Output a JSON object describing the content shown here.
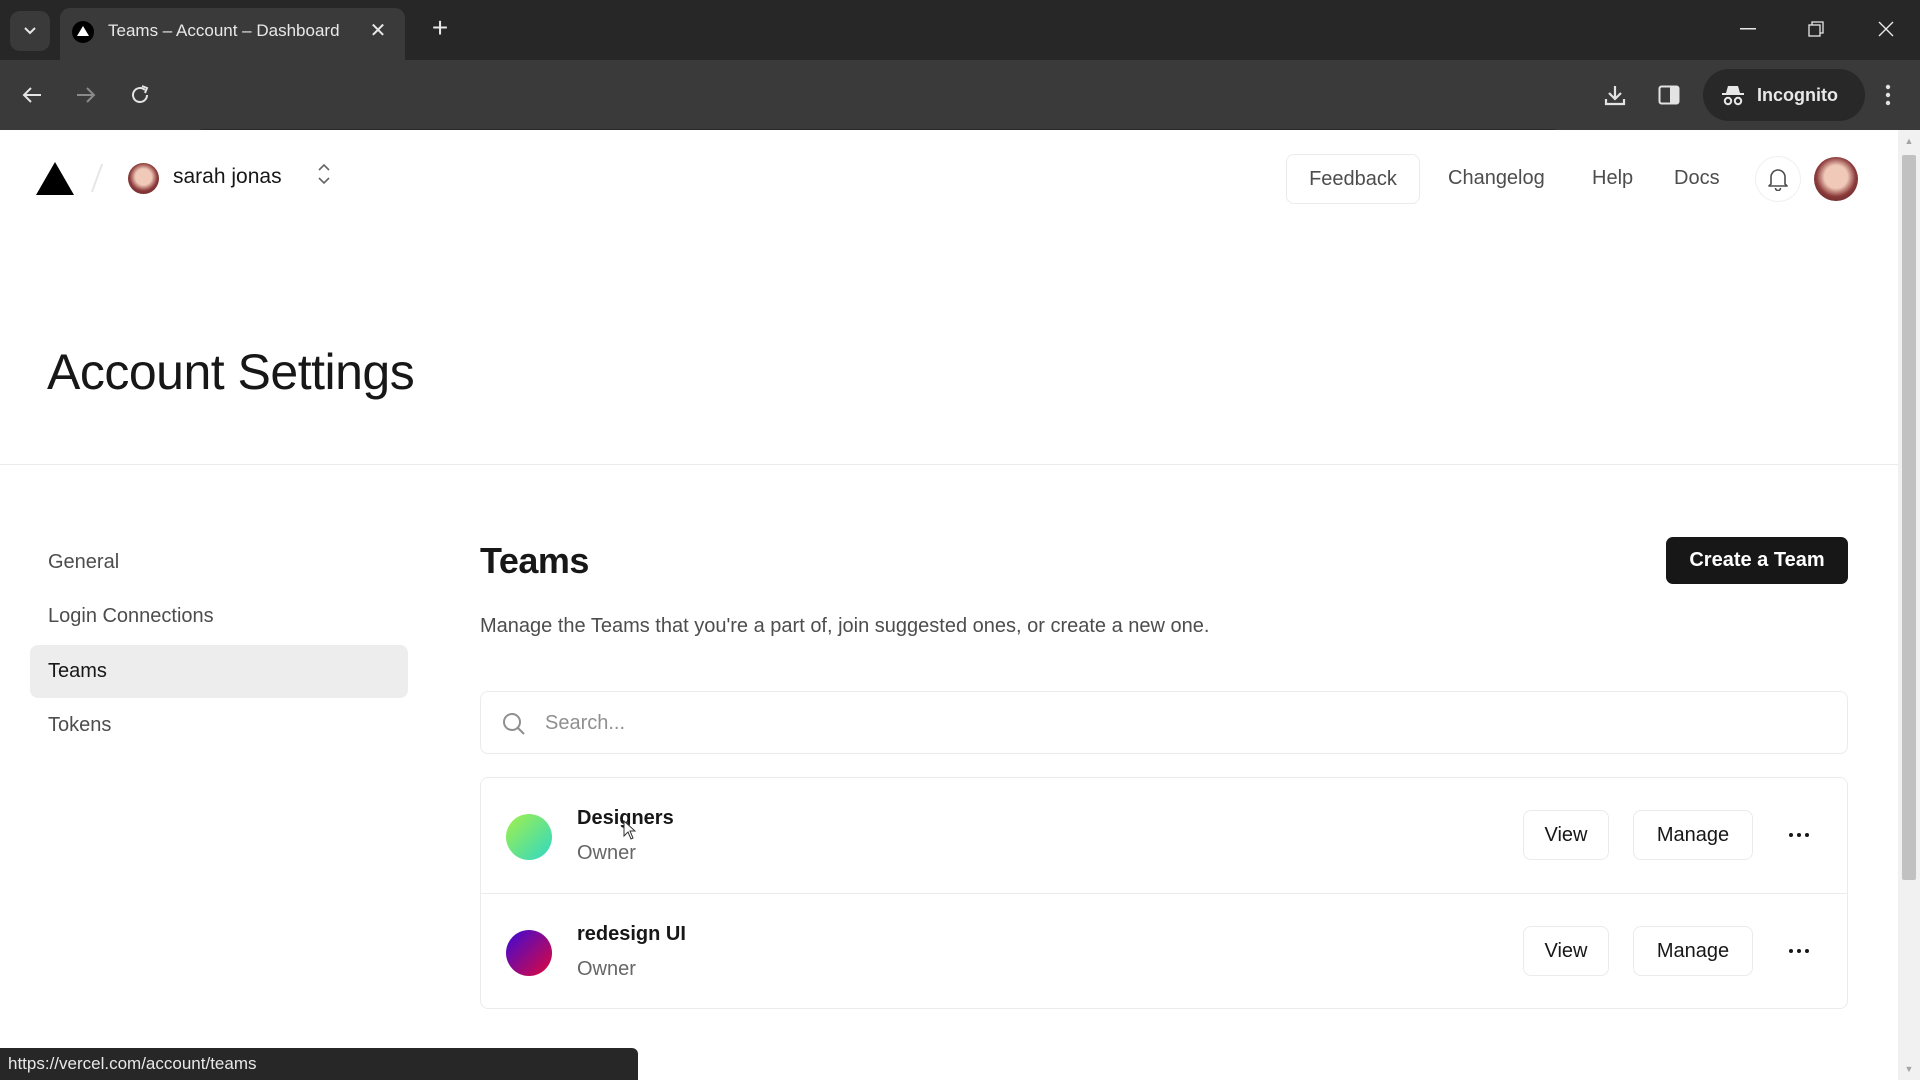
{
  "browser": {
    "tab": {
      "title": "Teams – Account – Dashboard"
    },
    "address": {
      "url": "vercel.com/account/teams"
    },
    "profile_label": "Incognito",
    "status_url": "https://vercel.com/account/teams"
  },
  "header": {
    "account_name": "sarah jonas",
    "feedback_label": "Feedback",
    "links": [
      {
        "label": "Changelog"
      },
      {
        "label": "Help"
      },
      {
        "label": "Docs"
      }
    ]
  },
  "page": {
    "title": "Account Settings"
  },
  "sidebar": {
    "items": [
      {
        "label": "General",
        "active": false
      },
      {
        "label": "Login Connections",
        "active": false
      },
      {
        "label": "Teams",
        "active": true
      },
      {
        "label": "Tokens",
        "active": false
      }
    ]
  },
  "teams": {
    "heading": "Teams",
    "description": "Manage the Teams that you're a part of, join suggested ones, or create a new one.",
    "create_label": "Create a Team",
    "search_placeholder": "Search...",
    "search_value": "",
    "list": [
      {
        "name": "Designers",
        "role": "Owner",
        "avatar_colors": [
          "#a3f04a",
          "#2fd8c4"
        ],
        "view_label": "View",
        "manage_label": "Manage"
      },
      {
        "name": "redesign UI",
        "role": "Owner",
        "avatar_colors": [
          "#3b0ad8",
          "#e0093a"
        ],
        "view_label": "View",
        "manage_label": "Manage"
      }
    ]
  }
}
